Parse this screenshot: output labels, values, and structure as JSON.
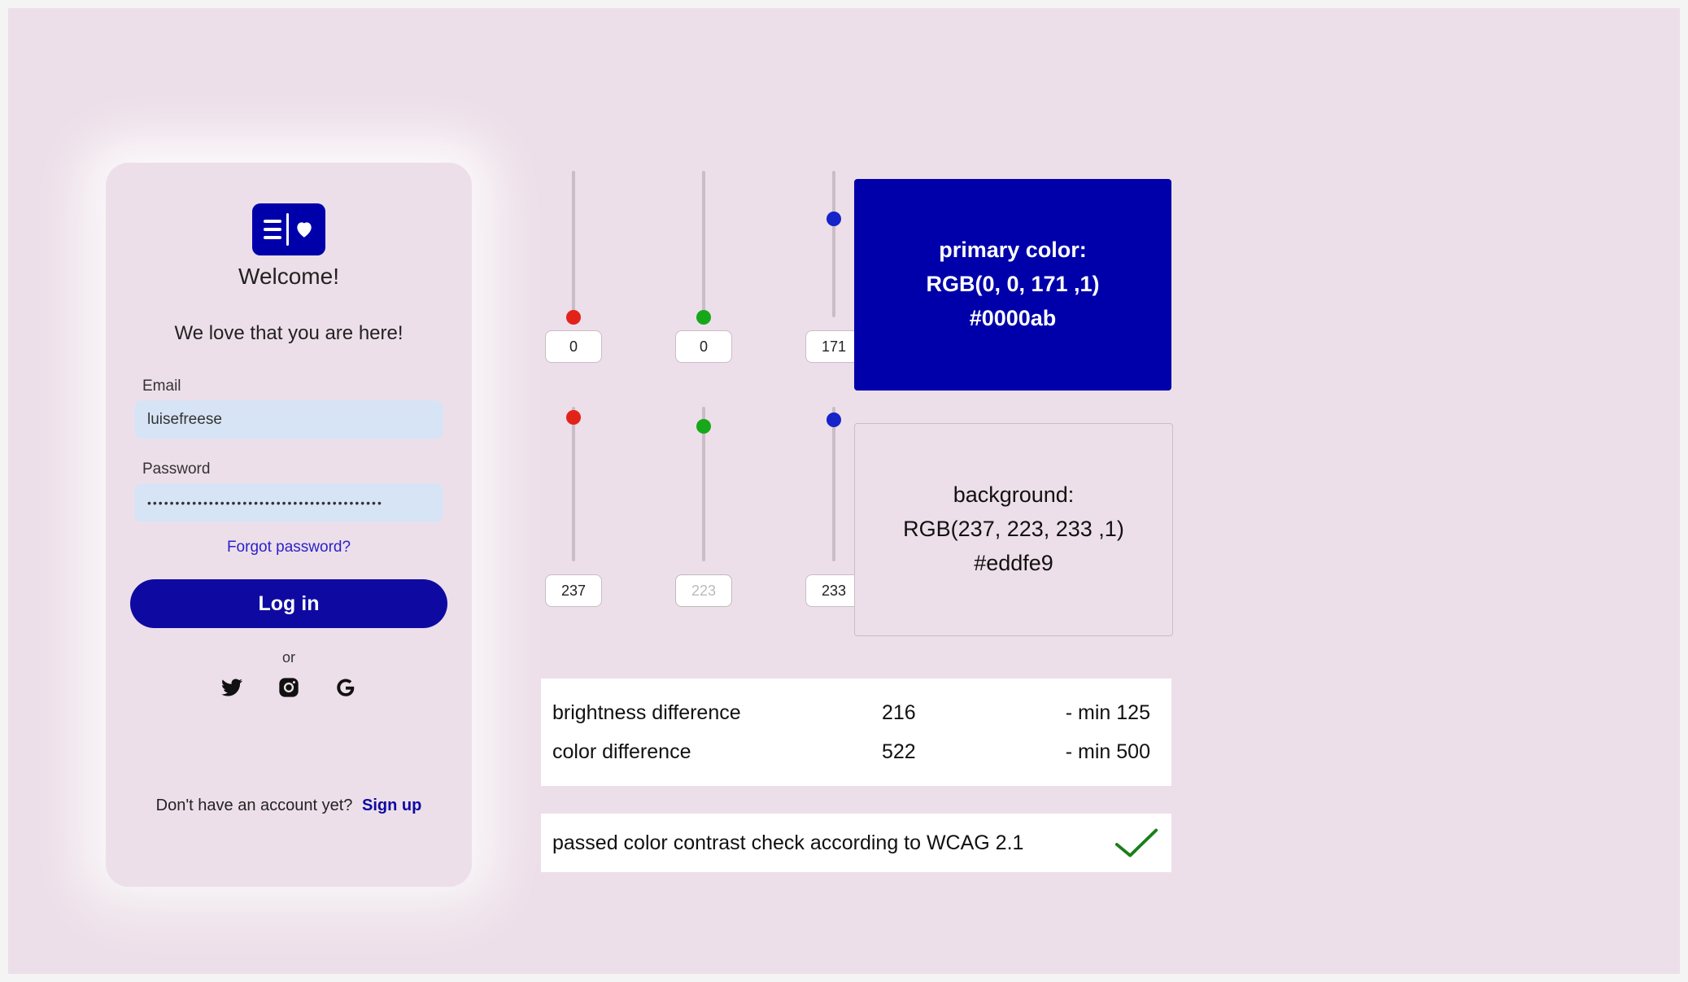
{
  "colors": {
    "primary_hex": "#0000ab",
    "background_hex": "#eddfe9"
  },
  "login": {
    "welcome": "Welcome!",
    "subheading": "We love that you are here!",
    "email_label": "Email",
    "email_value": "luisefreese",
    "password_label": "Password",
    "password_value": "••••••••••••••••••••••••••••••••••••••••••",
    "forgot": "Forgot password?",
    "button": "Log in",
    "or": "or",
    "signup_prompt": "Don't have an account yet?",
    "signup_link": "Sign up"
  },
  "sliders": {
    "primary": {
      "r": 0,
      "g": 0,
      "b": 171
    },
    "background": {
      "r": 237,
      "g": 223,
      "b": 233
    }
  },
  "swatches": {
    "primary_title": "primary color:",
    "primary_rgb": "RGB(0, 0, 171 ,1)",
    "primary_hex": "#0000ab",
    "bg_title": "background:",
    "bg_rgb": "RGB(237, 223, 233 ,1)",
    "bg_hex": "#eddfe9"
  },
  "results": {
    "brightness_label": "brightness difference",
    "brightness_value": "216",
    "brightness_min": "- min 125",
    "color_label": "color difference",
    "color_value": "522",
    "color_min": "- min 500",
    "passed_text": "passed color contrast check according to WCAG 2.1"
  }
}
